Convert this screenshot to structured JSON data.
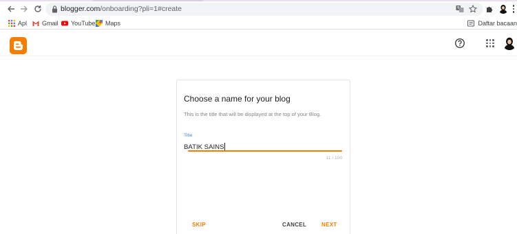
{
  "browser": {
    "url_host": "blogger.com",
    "url_path": "/onboarding?pli=1#create",
    "icons": [
      "back-arrow-icon",
      "forward-arrow-icon",
      "reload-icon",
      "lock-icon",
      "translate-icon",
      "star-icon",
      "puzzle-icon"
    ]
  },
  "bookmarks": {
    "items": [
      {
        "label": "Apl",
        "icon": "apps-grid-icon"
      },
      {
        "label": "Gmail",
        "icon": "gmail-icon"
      },
      {
        "label": "YouTube",
        "icon": "youtube-icon"
      },
      {
        "label": "Maps",
        "icon": "maps-icon"
      }
    ],
    "reading_list": "Daftar bacaan"
  },
  "app": {
    "logo": "blogger-logo",
    "icons": [
      "help-icon",
      "google-apps-icon",
      "account-avatar"
    ]
  },
  "dialog": {
    "title": "Choose a name for your blog",
    "description": "This is the title that will be displayed at the top of your Blog.",
    "field_label": "Title",
    "field_value": "BATIK SAINS",
    "counter": "11 / 100",
    "skip_label": "SKIP",
    "cancel_label": "CANCEL",
    "next_label": "NEXT"
  },
  "colors": {
    "accent": "#f57d00",
    "label_blue": "#4285f4"
  }
}
